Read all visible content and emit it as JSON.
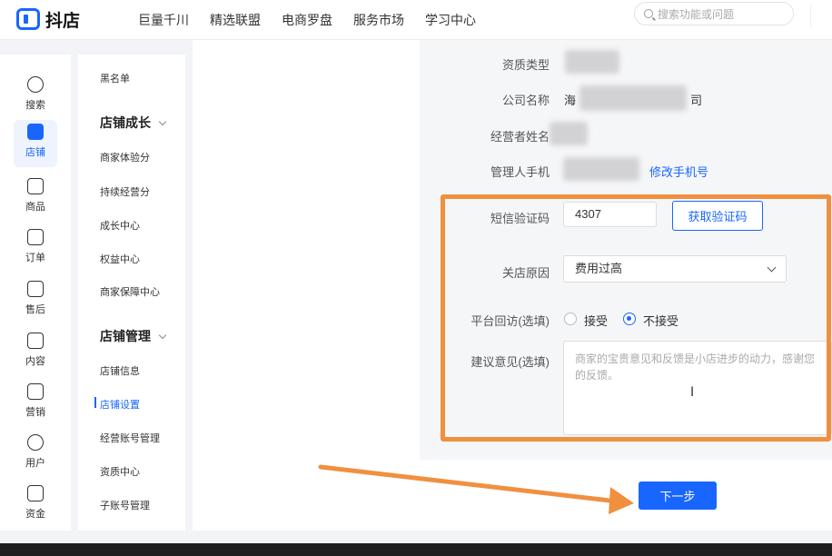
{
  "header": {
    "logo_text": "抖店",
    "nav": [
      "巨量千川",
      "精选联盟",
      "电商罗盘",
      "服务市场",
      "学习中心"
    ],
    "search_placeholder": "搜索功能或问题"
  },
  "rail": {
    "items": [
      {
        "label": "搜索",
        "icon": "search-icon"
      },
      {
        "label": "店铺",
        "icon": "shop-icon"
      },
      {
        "label": "商品",
        "icon": "bag-icon"
      },
      {
        "label": "订单",
        "icon": "order-icon"
      },
      {
        "label": "售后",
        "icon": "after-sale-icon"
      },
      {
        "label": "内容",
        "icon": "tv-icon"
      },
      {
        "label": "营销",
        "icon": "megaphone-icon"
      },
      {
        "label": "用户",
        "icon": "user-icon"
      },
      {
        "label": "资金",
        "icon": "wallet-icon"
      }
    ]
  },
  "submenu": {
    "top_item": "黑名单",
    "group1": {
      "title": "店铺成长",
      "items": [
        "商家体验分",
        "持续经营分",
        "成长中心",
        "权益中心",
        "商家保障中心"
      ]
    },
    "group2": {
      "title": "店铺管理",
      "items": [
        "店铺信息",
        "店铺设置",
        "经营账号管理",
        "资质中心",
        "子账号管理"
      ]
    }
  },
  "form": {
    "qual_type_label": "资质类型",
    "company_label": "公司名称",
    "company_prefix": "海",
    "company_suffix": "司",
    "operator_label": "经营者姓名",
    "admin_phone_label": "管理人手机",
    "change_phone_link": "修改手机号",
    "sms_label": "短信验证码",
    "sms_value": "4307",
    "get_code_button": "获取验证码",
    "close_reason_label": "关店原因",
    "close_reason_value": "费用过高",
    "revisit_label": "平台回访(选填)",
    "revisit_accept": "接受",
    "revisit_reject": "不接受",
    "suggestion_label": "建议意见(选填)",
    "suggestion_placeholder": "商家的宝贵意见和反馈是小店进步的动力，感谢您的反馈。",
    "next_button": "下一步"
  }
}
